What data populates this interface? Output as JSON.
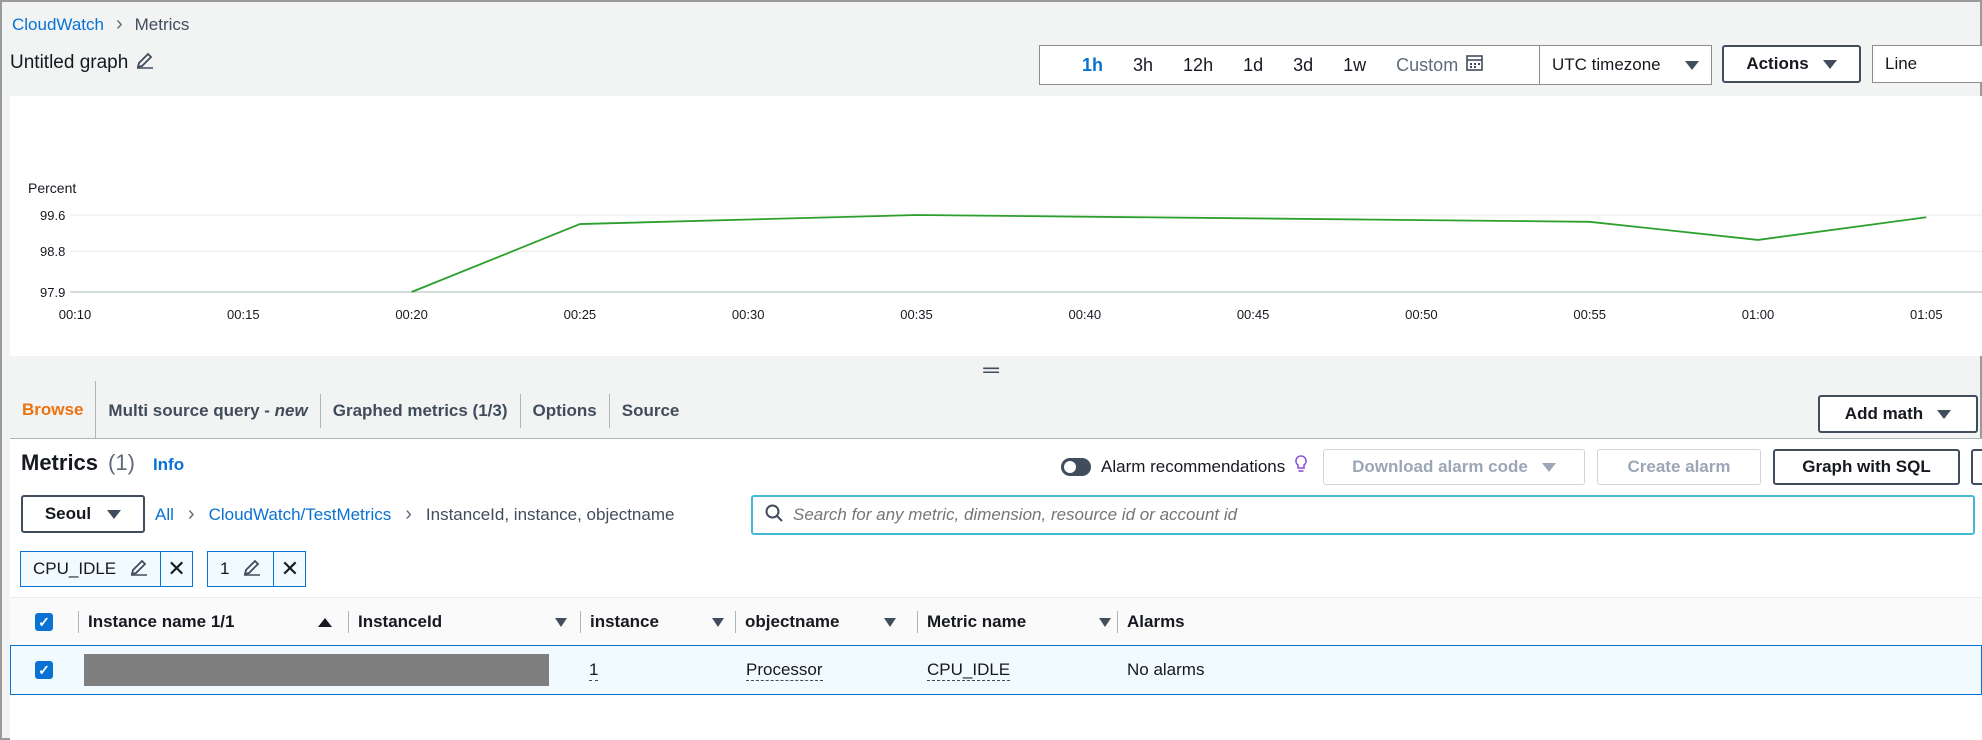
{
  "breadcrumb": {
    "root": "CloudWatch",
    "current": "Metrics"
  },
  "graph": {
    "title": "Untitled graph"
  },
  "time_ranges": [
    "1h",
    "3h",
    "12h",
    "1d",
    "3d",
    "1w"
  ],
  "time_active": "1h",
  "custom_label": "Custom",
  "timezone": "UTC timezone",
  "actions_label": "Actions",
  "graph_type": "Line",
  "chart_data": {
    "type": "line",
    "ylabel": "Percent",
    "yticks": [
      97.9,
      98.8,
      99.6
    ],
    "xticks": [
      "00:10",
      "00:15",
      "00:20",
      "00:25",
      "00:30",
      "00:35",
      "00:40",
      "00:45",
      "00:50",
      "00:55",
      "01:00",
      "01:05"
    ],
    "series": [
      {
        "color": "#2ca02c",
        "points": [
          {
            "t": 20,
            "v": 97.9
          },
          {
            "t": 25,
            "v": 99.4
          },
          {
            "t": 35,
            "v": 99.6
          },
          {
            "t": 55,
            "v": 99.45
          },
          {
            "t": 60,
            "v": 99.05
          },
          {
            "t": 65,
            "v": 99.55
          }
        ]
      }
    ]
  },
  "tabs": {
    "browse": "Browse",
    "multi_prefix": "Multi source query - ",
    "multi_new": "new",
    "graphed": "Graphed metrics (1/3)",
    "options": "Options",
    "source": "Source"
  },
  "add_math": "Add math",
  "metrics": {
    "title": "Metrics",
    "count": "(1)",
    "info": "Info",
    "alarm_recommendations": "Alarm recommendations",
    "download_alarm_code": "Download alarm code",
    "create_alarm": "Create alarm",
    "graph_with_sql": "Graph with SQL"
  },
  "region": "Seoul",
  "namespace_bc": {
    "all": "All",
    "namespace": "CloudWatch/TestMetrics",
    "dimensions": "InstanceId, instance, objectname"
  },
  "search": {
    "placeholder": "Search for any metric, dimension, resource id or account id"
  },
  "tokens": [
    "CPU_IDLE",
    "1"
  ],
  "table": {
    "headers": {
      "instance_name": "Instance name 1/1",
      "instance_id": "InstanceId",
      "instance": "instance",
      "objectname": "objectname",
      "metric_name": "Metric name",
      "alarms": "Alarms"
    },
    "rows": [
      {
        "instance": "1",
        "objectname": "Processor",
        "metric_name": "CPU_IDLE",
        "alarms": "No alarms"
      }
    ]
  }
}
